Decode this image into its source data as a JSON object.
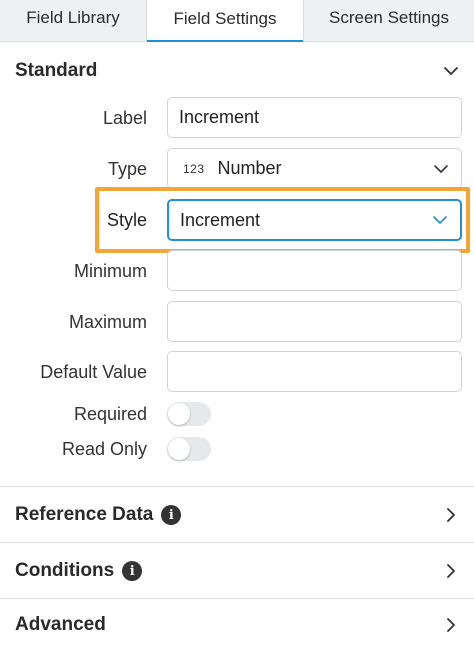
{
  "tabs": [
    {
      "label": "Field Library"
    },
    {
      "label": "Field Settings"
    },
    {
      "label": "Screen Settings"
    }
  ],
  "standard": {
    "title": "Standard",
    "label_caption": "Label",
    "label_value": "Increment",
    "type_caption": "Type",
    "type_prefix": "123",
    "type_value": "Number",
    "style_caption": "Style",
    "style_value": "Increment",
    "minimum_caption": "Minimum",
    "minimum_value": "",
    "maximum_caption": "Maximum",
    "maximum_value": "",
    "default_caption": "Default Value",
    "default_value": "",
    "required_caption": "Required",
    "required_on": false,
    "readonly_caption": "Read Only",
    "readonly_on": false
  },
  "sections": {
    "reference_data": "Reference Data",
    "conditions": "Conditions",
    "advanced": "Advanced"
  },
  "colors": {
    "accent": "#1f8fd6",
    "highlight": "#f3a536"
  },
  "icons": {
    "collapse": "chevron-down-icon",
    "expand": "chevron-right-icon",
    "info": "info-icon"
  }
}
